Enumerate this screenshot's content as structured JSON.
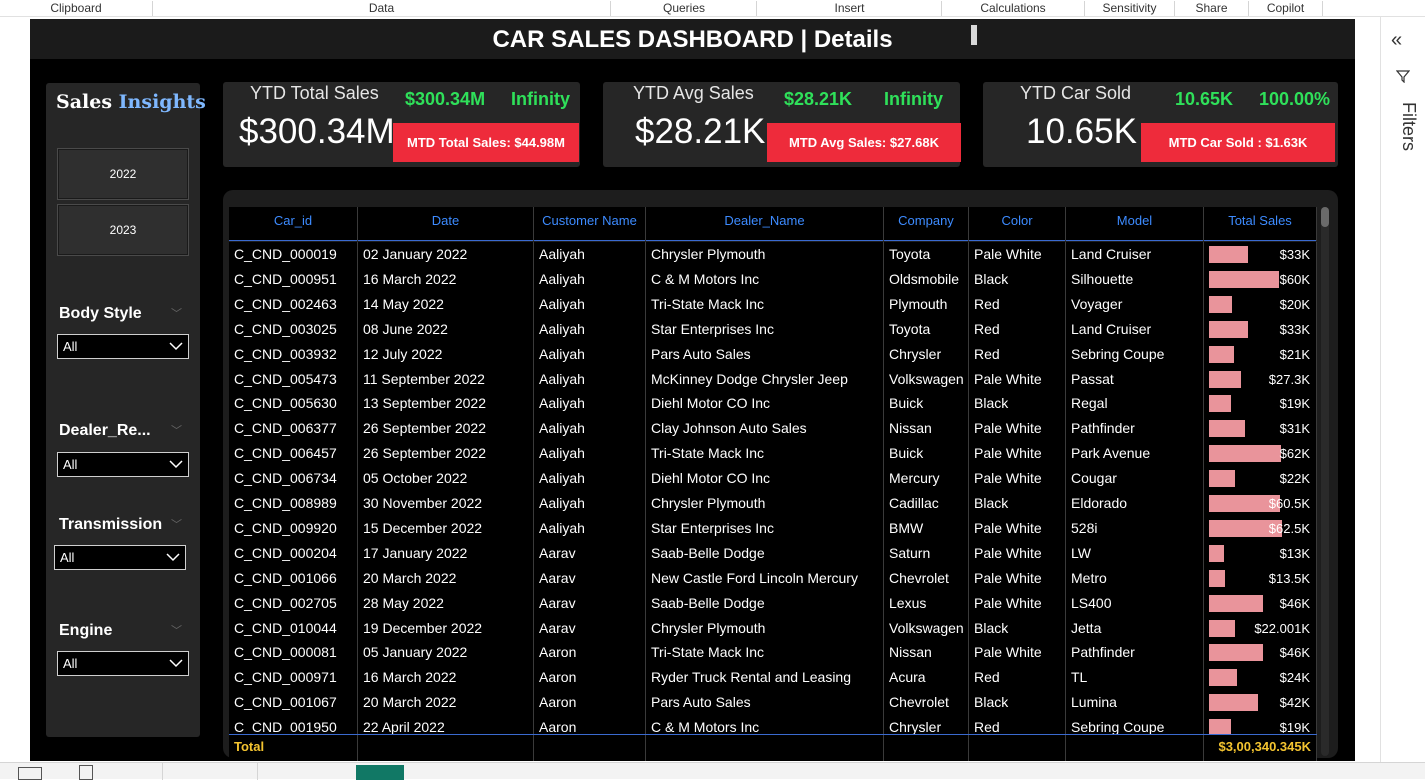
{
  "ribbon": {
    "groups": [
      "Clipboard",
      "Data",
      "Queries",
      "Insert",
      "Calculations",
      "Sensitivity",
      "Share",
      "Copilot"
    ]
  },
  "report": {
    "title": "CAR SALES DASHBOARD | Details",
    "brand_part1": "Sales",
    "brand_part2": "Insights",
    "years": [
      "2022",
      "2023"
    ],
    "slicers": [
      {
        "label": "Body Style",
        "value": "All"
      },
      {
        "label": "Dealer_Re...",
        "value": "All"
      },
      {
        "label": "Transmission",
        "value": "All"
      },
      {
        "label": "Engine",
        "value": "All"
      }
    ],
    "kpis": [
      {
        "label": "YTD Total Sales",
        "value": "$300.34M",
        "g1": "$300.34M",
        "g2": "Infinity",
        "mtd": "MTD Total Sales: $44.98M"
      },
      {
        "label": "YTD Avg Sales",
        "value": "$28.21K",
        "g1": "$28.21K",
        "g2": "Infinity",
        "mtd": "MTD Avg Sales: $27.68K"
      },
      {
        "label": "YTD Car Sold",
        "value": "10.65K",
        "g1": "10.65K",
        "g2": "100.00%",
        "mtd": "MTD Car Sold : $1.63K"
      }
    ],
    "table": {
      "columns": [
        "Car_id",
        "Date",
        "Customer Name",
        "Dealer_Name",
        "Company",
        "Color",
        "Model",
        "Total Sales"
      ],
      "rows": [
        {
          "car_id": "C_CND_000019",
          "date": "02 January 2022",
          "customer": "Aaliyah",
          "dealer": "Chrysler Plymouth",
          "company": "Toyota",
          "color": "Pale White",
          "model": "Land Cruiser",
          "sales": "$33K",
          "sales_num": 33000
        },
        {
          "car_id": "C_CND_000951",
          "date": "16 March 2022",
          "customer": "Aaliyah",
          "dealer": "C & M Motors Inc",
          "company": "Oldsmobile",
          "color": "Black",
          "model": "Silhouette",
          "sales": "$60K",
          "sales_num": 60000
        },
        {
          "car_id": "C_CND_002463",
          "date": "14 May 2022",
          "customer": "Aaliyah",
          "dealer": "Tri-State Mack Inc",
          "company": "Plymouth",
          "color": "Red",
          "model": "Voyager",
          "sales": "$20K",
          "sales_num": 20000
        },
        {
          "car_id": "C_CND_003025",
          "date": "08 June 2022",
          "customer": "Aaliyah",
          "dealer": "Star Enterprises Inc",
          "company": "Toyota",
          "color": "Red",
          "model": "Land Cruiser",
          "sales": "$33K",
          "sales_num": 33000
        },
        {
          "car_id": "C_CND_003932",
          "date": "12 July 2022",
          "customer": "Aaliyah",
          "dealer": "Pars Auto Sales",
          "company": "Chrysler",
          "color": "Red",
          "model": "Sebring Coupe",
          "sales": "$21K",
          "sales_num": 21000
        },
        {
          "car_id": "C_CND_005473",
          "date": "11 September 2022",
          "customer": "Aaliyah",
          "dealer": "McKinney Dodge Chrysler Jeep",
          "company": "Volkswagen",
          "color": "Pale White",
          "model": "Passat",
          "sales": "$27.3K",
          "sales_num": 27300
        },
        {
          "car_id": "C_CND_005630",
          "date": "13 September 2022",
          "customer": "Aaliyah",
          "dealer": "Diehl Motor CO Inc",
          "company": "Buick",
          "color": "Black",
          "model": "Regal",
          "sales": "$19K",
          "sales_num": 19000
        },
        {
          "car_id": "C_CND_006377",
          "date": "26 September 2022",
          "customer": "Aaliyah",
          "dealer": "Clay Johnson Auto Sales",
          "company": "Nissan",
          "color": "Pale White",
          "model": "Pathfinder",
          "sales": "$31K",
          "sales_num": 31000
        },
        {
          "car_id": "C_CND_006457",
          "date": "26 September 2022",
          "customer": "Aaliyah",
          "dealer": "Tri-State Mack Inc",
          "company": "Buick",
          "color": "Pale White",
          "model": "Park Avenue",
          "sales": "$62K",
          "sales_num": 62000
        },
        {
          "car_id": "C_CND_006734",
          "date": "05 October 2022",
          "customer": "Aaliyah",
          "dealer": "Diehl Motor CO Inc",
          "company": "Mercury",
          "color": "Pale White",
          "model": "Cougar",
          "sales": "$22K",
          "sales_num": 22000
        },
        {
          "car_id": "C_CND_008989",
          "date": "30 November 2022",
          "customer": "Aaliyah",
          "dealer": "Chrysler Plymouth",
          "company": "Cadillac",
          "color": "Black",
          "model": "Eldorado",
          "sales": "$60.5K",
          "sales_num": 60500
        },
        {
          "car_id": "C_CND_009920",
          "date": "15 December 2022",
          "customer": "Aaliyah",
          "dealer": "Star Enterprises Inc",
          "company": "BMW",
          "color": "Pale White",
          "model": "528i",
          "sales": "$62.5K",
          "sales_num": 62500
        },
        {
          "car_id": "C_CND_000204",
          "date": "17 January 2022",
          "customer": "Aarav",
          "dealer": "Saab-Belle Dodge",
          "company": "Saturn",
          "color": "Pale White",
          "model": "LW",
          "sales": "$13K",
          "sales_num": 13000
        },
        {
          "car_id": "C_CND_001066",
          "date": "20 March 2022",
          "customer": "Aarav",
          "dealer": "New Castle Ford Lincoln Mercury",
          "company": "Chevrolet",
          "color": "Pale White",
          "model": "Metro",
          "sales": "$13.5K",
          "sales_num": 13500
        },
        {
          "car_id": "C_CND_002705",
          "date": "28 May 2022",
          "customer": "Aarav",
          "dealer": "Saab-Belle Dodge",
          "company": "Lexus",
          "color": "Pale White",
          "model": "LS400",
          "sales": "$46K",
          "sales_num": 46000
        },
        {
          "car_id": "C_CND_010044",
          "date": "19 December 2022",
          "customer": "Aarav",
          "dealer": "Chrysler Plymouth",
          "company": "Volkswagen",
          "color": "Black",
          "model": "Jetta",
          "sales": "$22.001K",
          "sales_num": 22001
        },
        {
          "car_id": "C_CND_000081",
          "date": "05 January 2022",
          "customer": "Aaron",
          "dealer": "Tri-State Mack Inc",
          "company": "Nissan",
          "color": "Pale White",
          "model": "Pathfinder",
          "sales": "$46K",
          "sales_num": 46000
        },
        {
          "car_id": "C_CND_000971",
          "date": "16 March 2022",
          "customer": "Aaron",
          "dealer": "Ryder Truck Rental and Leasing",
          "company": "Acura",
          "color": "Red",
          "model": "TL",
          "sales": "$24K",
          "sales_num": 24000
        },
        {
          "car_id": "C_CND_001067",
          "date": "20 March 2022",
          "customer": "Aaron",
          "dealer": "Pars Auto Sales",
          "company": "Chevrolet",
          "color": "Black",
          "model": "Lumina",
          "sales": "$42K",
          "sales_num": 42000
        },
        {
          "car_id": "C_CND_001950",
          "date": "22 April 2022",
          "customer": "Aaron",
          "dealer": "C & M Motors Inc",
          "company": "Chrysler",
          "color": "Red",
          "model": "Sebring Coupe",
          "sales": "$19K",
          "sales_num": 19000
        }
      ],
      "total_label": "Total",
      "total_value": "$3,00,340.345K",
      "bar_max": 62500
    }
  },
  "filters": {
    "label": "Filters"
  },
  "colors": {
    "accent_green": "#2fe05a",
    "mtd_red": "#ee2b3b",
    "header_blue": "#3d8bff",
    "bar_pink": "#e9949b",
    "total_yellow": "#f4c430"
  }
}
